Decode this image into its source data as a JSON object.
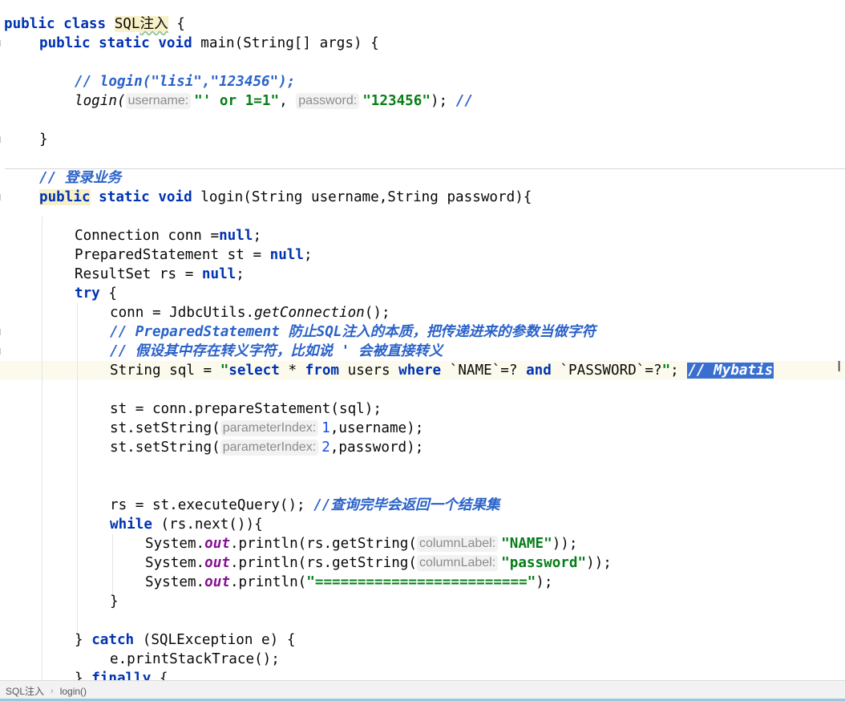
{
  "code": {
    "line1": {
      "kw1": "public",
      "kw2": "class",
      "cls_a": "SQL",
      "cls_b": "注入",
      "tail": " {"
    },
    "line2": {
      "kw1": "public",
      "kw2": "static",
      "kw3": "void",
      "sig": " main(String[] args) {"
    },
    "line3": {
      "comment": "// login(\"lisi\",\"123456\");"
    },
    "line4": {
      "call": "login(",
      "hint1": "username:",
      "str1": "\"' or 1=1\"",
      "comma": ",",
      "hint2": "password:",
      "str2": "\"123456\"",
      "tail": ");",
      "comment": "//"
    },
    "line5": {
      "brace": "}"
    },
    "line6": {
      "comment": "// 登录业务"
    },
    "line7": {
      "kw1": "public",
      "kw2": "static",
      "kw3": "void",
      "sig": " login(String username,String password){"
    },
    "line8": {
      "pre": "Connection conn =",
      "kw": "null",
      "post": ";"
    },
    "line9": {
      "pre": "PreparedStatement st = ",
      "kw": "null",
      "post": ";"
    },
    "line10": {
      "pre": "ResultSet rs = ",
      "kw": "null",
      "post": ";"
    },
    "line11": {
      "kw": "try",
      "post": " {"
    },
    "line12": {
      "pre": "conn = JdbcUtils.",
      "method": "getConnection",
      "post": "();"
    },
    "line13": {
      "comment": "// PreparedStatement 防止SQL注入的本质，把传递进来的参数当做字符"
    },
    "line14": {
      "comment": "// 假设其中存在转义字符，比如说 ' 会被直接转义"
    },
    "line15": {
      "pre": "String sql = ",
      "q1": "\"",
      "k1": "select",
      "s1": " * ",
      "k2": "from",
      "s2": " users ",
      "k3": "where",
      "s3": " `NAME`=? ",
      "k4": "and",
      "s4": " `PASSWORD`=?",
      "q2": "\"",
      "post": "; ",
      "comment": "// Mybatis"
    },
    "line16": {
      "text": "st = conn.prepareStatement(sql);"
    },
    "line17": {
      "pre": "st.setString(",
      "hint": "parameterIndex:",
      "num": "1",
      "post": ",username);"
    },
    "line18": {
      "pre": "st.setString(",
      "hint": "parameterIndex:",
      "num": "2",
      "post": ",password);"
    },
    "line19": {
      "pre": "rs = st.executeQuery(); ",
      "comment": "//查询完毕会返回一个结果集"
    },
    "line20": {
      "kw": "while",
      "post": " (rs.next()){"
    },
    "line21": {
      "pre": "System.",
      "fld": "out",
      "mid": ".println(rs.getString(",
      "hint": "columnLabel:",
      "str": "\"NAME\"",
      "post": "));"
    },
    "line22": {
      "pre": "System.",
      "fld": "out",
      "mid": ".println(rs.getString(",
      "hint": "columnLabel:",
      "str": "\"password\"",
      "post": "));"
    },
    "line23": {
      "pre": "System.",
      "fld": "out",
      "mid": ".println(",
      "str": "\"=========================\"",
      "post": ");"
    },
    "line24": {
      "brace": "}"
    },
    "line25": {
      "pre": "} ",
      "kw": "catch",
      "post": " (SQLException e) {"
    },
    "line26": {
      "text": "e.printStackTrace();"
    },
    "line27": {
      "pre": "} ",
      "kw": "finally",
      "post": " {"
    }
  },
  "statusbar": {
    "crumb1": "SQL注入",
    "sep": "›",
    "crumb2": "login()"
  },
  "cursor_glyph": "I",
  "colors": {
    "keyword": "#0033b3",
    "string": "#067d17",
    "number": "#1750eb",
    "comment": "#2a62c9",
    "field": "#871094",
    "selection": "#3a6fd0",
    "caret_row": "#fcfaed"
  }
}
